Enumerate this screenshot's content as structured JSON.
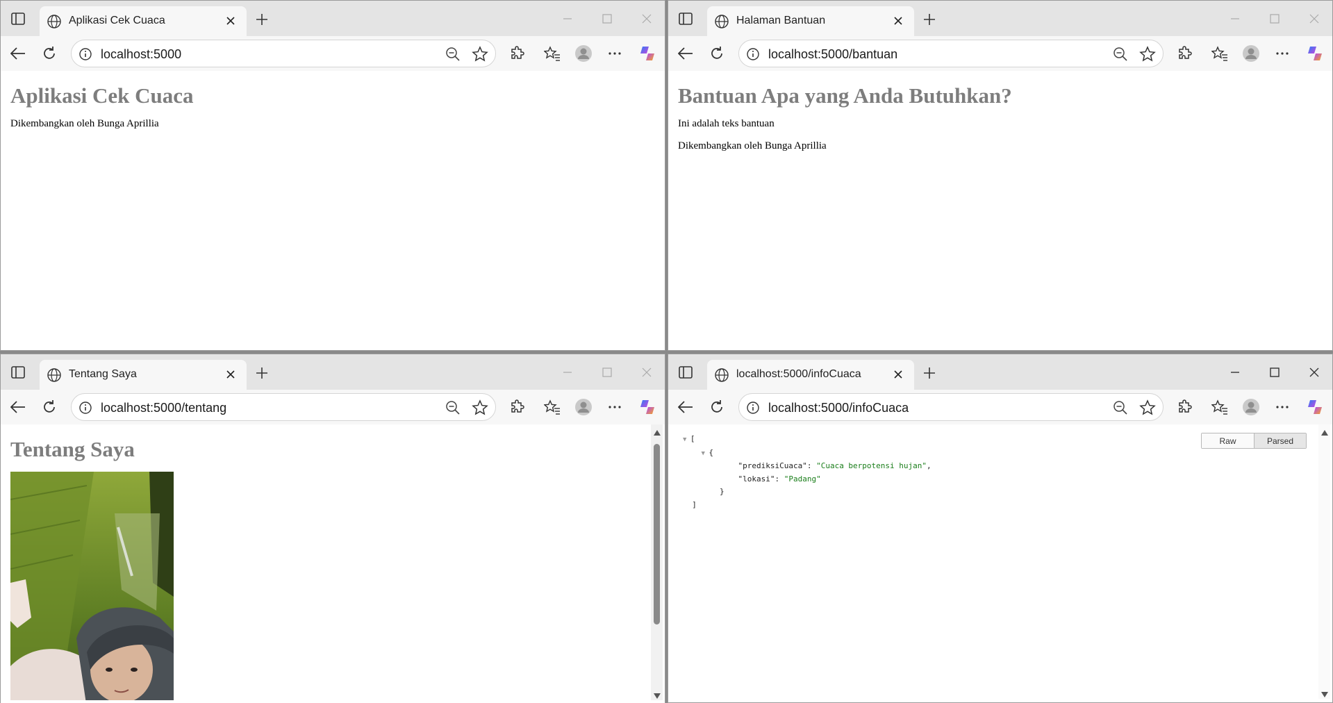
{
  "windows": [
    {
      "tab_title": "Aplikasi Cek Cuaca",
      "url": "localhost:5000",
      "heading": "Aplikasi Cek Cuaca",
      "paragraphs": [
        "Dikembangkan oleh Bunga Aprillia"
      ]
    },
    {
      "tab_title": "Halaman Bantuan",
      "url": "localhost:5000/bantuan",
      "heading": "Bantuan Apa yang Anda Butuhkan?",
      "paragraphs": [
        "Ini adalah teks bantuan",
        "Dikembangkan oleh Bunga Aprillia"
      ]
    },
    {
      "tab_title": "Tentang Saya",
      "url": "localhost:5000/tentang",
      "heading": "Tentang Saya"
    },
    {
      "tab_title": "localhost:5000/infoCuaca",
      "url": "localhost:5000/infoCuaca",
      "json_viewer": {
        "raw_label": "Raw",
        "parsed_label": "Parsed",
        "open_bracket": "[",
        "open_brace": "{",
        "key1": "\"prediksiCuaca\"",
        "val1": "\"Cuaca berpotensi hujan\"",
        "key2": "\"lokasi\"",
        "val2": "\"Padang\"",
        "close_brace": "}",
        "close_bracket": "]"
      }
    }
  ],
  "icons": {
    "sidebar": "sidebar-icon",
    "tab_favicon": "globe-icon",
    "tab_close": "close-icon",
    "new_tab": "plus-icon",
    "back": "back-arrow-icon",
    "reload": "reload-icon",
    "site_info": "info-icon",
    "zoom": "zoom-out-icon",
    "favorite": "star-icon",
    "extensions": "puzzle-icon",
    "favorites": "favorites-icon",
    "profile": "profile-icon",
    "more": "more-icon",
    "copilot": "copilot-icon"
  },
  "colors": {
    "heading": "#7d7d7d",
    "json_string": "#1a7e1a",
    "tabbar": "#e4e4e4",
    "toolbar": "#f7f7f7"
  }
}
